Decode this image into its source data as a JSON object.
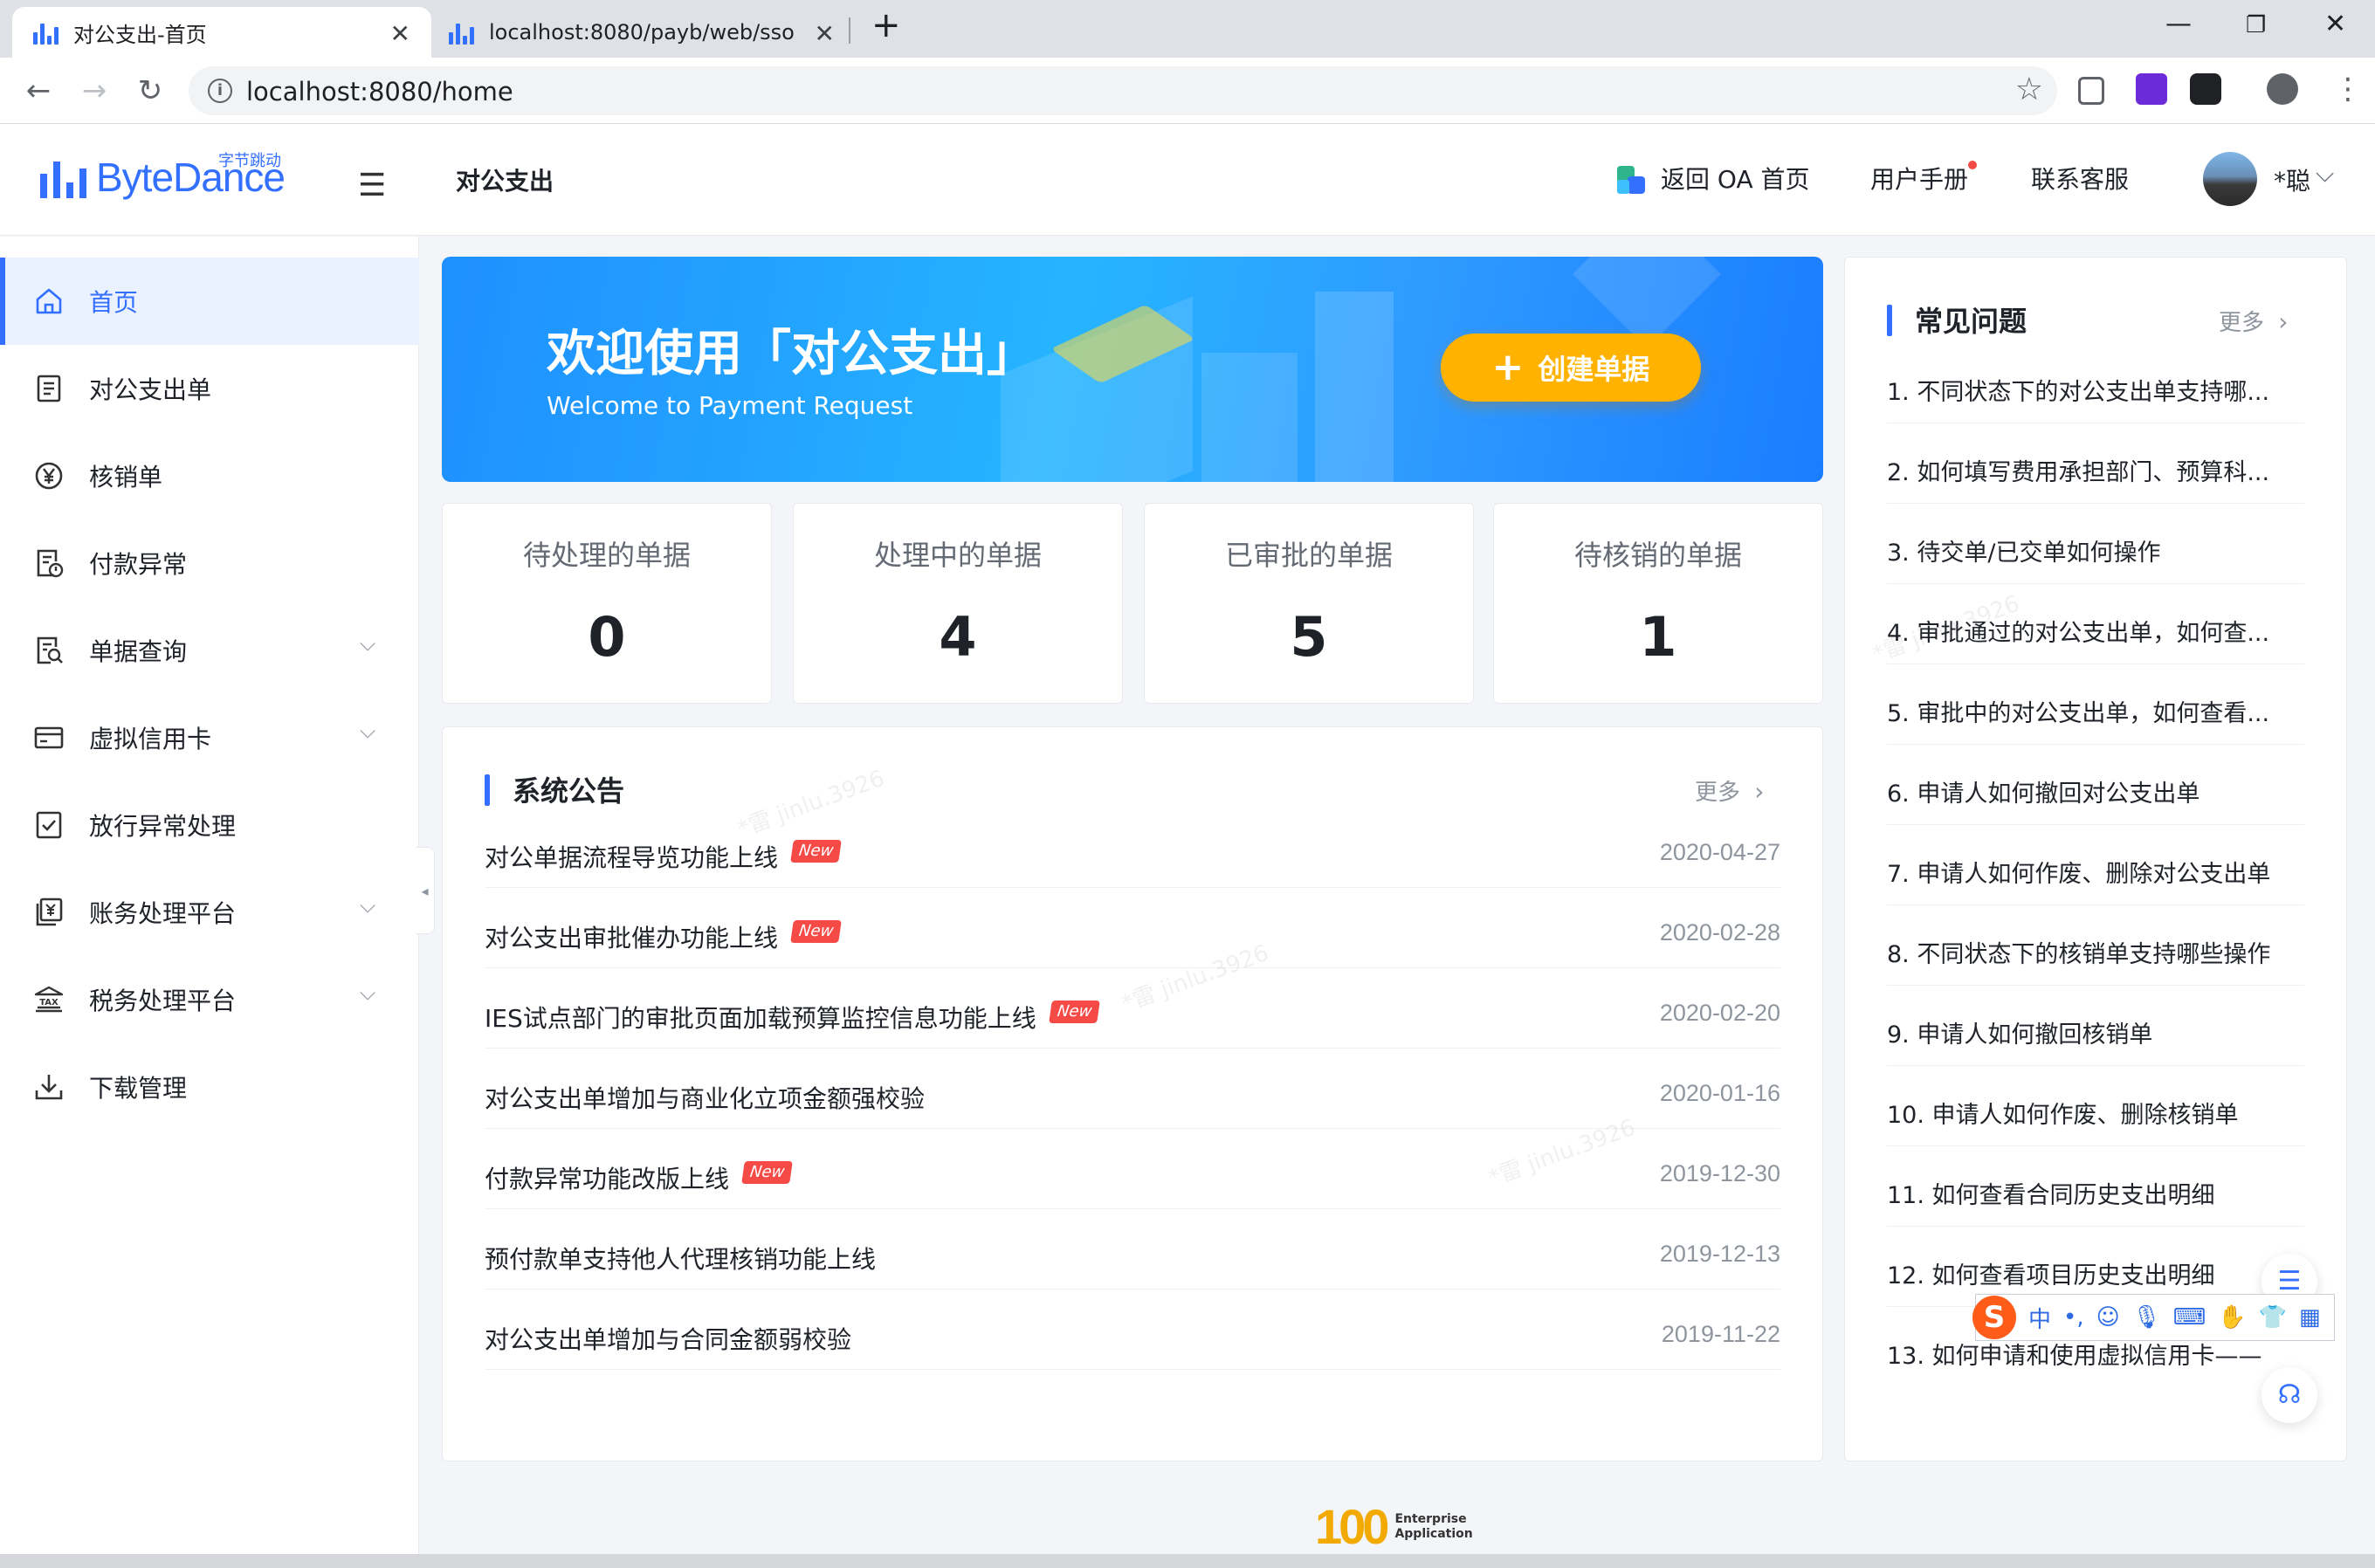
{
  "browser": {
    "tabs": [
      {
        "title": "对公支出-首页",
        "active": true
      },
      {
        "title": "localhost:8080/payb/web/sso/",
        "active": false
      }
    ],
    "new_tab": "+",
    "url": "localhost:8080/home"
  },
  "header": {
    "logo_text": "ByteDance",
    "logo_cn": "字节跳动",
    "app_title": "对公支出",
    "oa_link": "返回 OA 首页",
    "manual": "用户手册",
    "support": "联系客服",
    "user_name": "*聪"
  },
  "sidebar": {
    "items": [
      {
        "label": "首页",
        "icon": "home-icon",
        "active": true,
        "expandable": false
      },
      {
        "label": "对公支出单",
        "icon": "document-icon",
        "active": false,
        "expandable": false
      },
      {
        "label": "核销单",
        "icon": "yen-circle-icon",
        "active": false,
        "expandable": false
      },
      {
        "label": "付款异常",
        "icon": "doc-warning-icon",
        "active": false,
        "expandable": false
      },
      {
        "label": "单据查询",
        "icon": "doc-search-icon",
        "active": false,
        "expandable": true
      },
      {
        "label": "虚拟信用卡",
        "icon": "credit-card-icon",
        "active": false,
        "expandable": true
      },
      {
        "label": "放行异常处理",
        "icon": "doc-check-icon",
        "active": false,
        "expandable": false
      },
      {
        "label": "账务处理平台",
        "icon": "ledger-icon",
        "active": false,
        "expandable": true
      },
      {
        "label": "税务处理平台",
        "icon": "tax-bank-icon",
        "active": false,
        "expandable": true
      },
      {
        "label": "下载管理",
        "icon": "download-icon",
        "active": false,
        "expandable": false
      }
    ]
  },
  "banner": {
    "title": "欢迎使用「对公支出」",
    "subtitle": "Welcome to Payment Request",
    "create_button": "创建单据"
  },
  "stats": [
    {
      "label": "待处理的单据",
      "value": "0"
    },
    {
      "label": "处理中的单据",
      "value": "4"
    },
    {
      "label": "已审批的单据",
      "value": "5"
    },
    {
      "label": "待核销的单据",
      "value": "1"
    }
  ],
  "notices": {
    "title": "系统公告",
    "more": "更多",
    "new_badge": "New",
    "items": [
      {
        "text": "对公单据流程导览功能上线",
        "date": "2020-04-27",
        "is_new": true
      },
      {
        "text": "对公支出审批催办功能上线",
        "date": "2020-02-28",
        "is_new": true
      },
      {
        "text": "IES试点部门的审批页面加载预算监控信息功能上线",
        "date": "2020-02-20",
        "is_new": true
      },
      {
        "text": "对公支出单增加与商业化立项金额强校验",
        "date": "2020-01-16",
        "is_new": false
      },
      {
        "text": "付款异常功能改版上线",
        "date": "2019-12-30",
        "is_new": true
      },
      {
        "text": "预付款单支持他人代理核销功能上线",
        "date": "2019-12-13",
        "is_new": false
      },
      {
        "text": "对公支出单增加与合同金额弱校验",
        "date": "2019-11-22",
        "is_new": false
      }
    ]
  },
  "faq": {
    "title": "常见问题",
    "more": "更多",
    "items": [
      "1. 不同状态下的对公支出单支持哪...",
      "2. 如何填写费用承担部门、预算科...",
      "3. 待交单/已交单如何操作",
      "4. 审批通过的对公支出单，如何查...",
      "5. 审批中的对公支出单，如何查看...",
      "6. 申请人如何撤回对公支出单",
      "7. 申请人如何作废、删除对公支出单",
      "8. 不同状态下的核销单支持哪些操作",
      "9. 申请人如何撤回核销单",
      "10. 申请人如何作废、删除核销单",
      "11. 如何查看合同历史支出明细",
      "12. 如何查看项目历史支出明细",
      "13. 如何申请和使用虚拟信用卡——"
    ]
  },
  "ime": {
    "mode": "中",
    "punct": "•,"
  },
  "footer": {
    "logo_number": "100",
    "logo_line1": "Enterprise",
    "logo_line2": "Application"
  },
  "watermark": "*雷 jinlu.3926"
}
